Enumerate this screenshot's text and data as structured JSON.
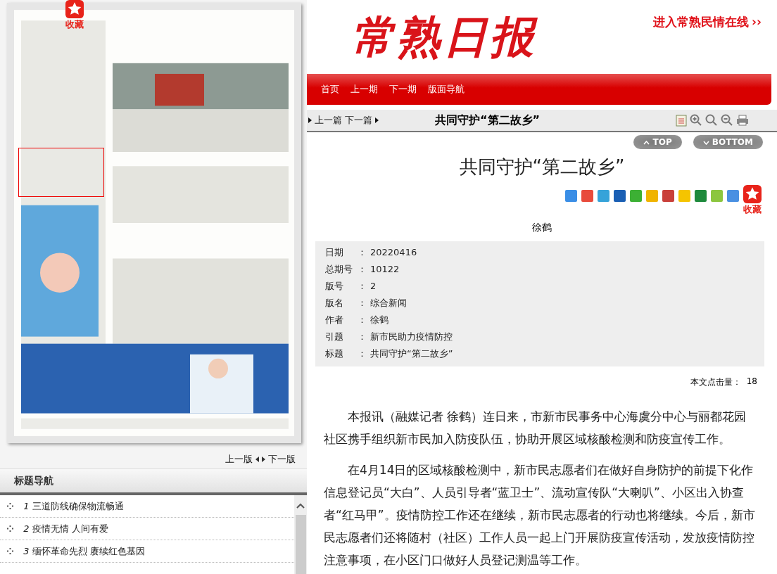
{
  "logo": "常熟日报",
  "header_link": {
    "label": "进入常熟民情在线",
    "arrows": "››"
  },
  "nav": [
    {
      "label": "首页"
    },
    {
      "label": "上一期"
    },
    {
      "label": "下一期"
    },
    {
      "label": "版面导航"
    }
  ],
  "page_preview": {
    "favorite": "收藏",
    "prev": "上一版",
    "next": "下一版"
  },
  "toolbar": {
    "prev": "上一篇",
    "next": "下一篇",
    "title": "共同守护“第二故乡”"
  },
  "scroll_buttons": [
    {
      "kind": "top",
      "label": "TOP"
    },
    {
      "kind": "bottom",
      "label": "BOTTOM"
    }
  ],
  "article": {
    "title": "共同守护“第二故乡”",
    "favorite": "收藏",
    "author": "徐鹤",
    "info": [
      {
        "label": "日期",
        "sep": "：",
        "value": "20220416"
      },
      {
        "label": "总期号",
        "sep": "：",
        "value": "10122"
      },
      {
        "label": "版号",
        "sep": "：",
        "value": "2"
      },
      {
        "label": "版名",
        "sep": "：",
        "value": "综合新闻"
      },
      {
        "label": "作者",
        "sep": "：",
        "value": "徐鹤"
      },
      {
        "label": "引题",
        "sep": "：",
        "value": "新市民助力疫情防控"
      },
      {
        "label": "标题",
        "sep": "：",
        "value": "共同守护“第二故乡”"
      }
    ],
    "hits_label": "本文点击量：",
    "hits": "18",
    "paragraphs": [
      "本报讯（融媒记者 徐鹤）连日来，市新市民事务中心海虞分中心与丽都花园社区携手组织新市民加入防疫队伍，协助开展区域核酸检测和防疫宣传工作。",
      "在4月14日的区域核酸检测中，新市民志愿者们在做好自身防护的前提下化作信息登记员“大白”、人员引导者“蓝卫士”、流动宣传队“大喇叭”、小区出入协查者“红马甲”。疫情防控工作还在继续，新市民志愿者的行动也将继续。今后，新市民志愿者们还将随村（社区）工作人员一起上门开展防疫宣传活动，发放疫情防控注意事项，在小区门口做好人员登记测温等工作。"
    ]
  },
  "title_nav": {
    "heading": "标题导航",
    "items": [
      {
        "number": "1",
        "title": "三道防线确保物流畅通"
      },
      {
        "number": "2",
        "title": "疫情无情 人间有爱"
      },
      {
        "number": "3",
        "title": "缅怀革命先烈 赓续红色基因"
      }
    ]
  }
}
